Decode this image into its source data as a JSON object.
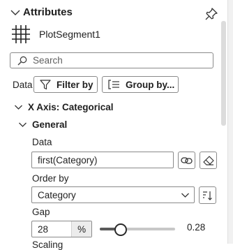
{
  "panel": {
    "title": "Attributes",
    "object_name": "PlotSegment1",
    "search_placeholder": "Search"
  },
  "data_row": {
    "label": "Data",
    "filter_label": "Filter by",
    "group_label": "Group by..."
  },
  "x_axis": {
    "section_label": "X Axis: Categorical",
    "general_label": "General",
    "data_label": "Data",
    "data_value": "first(Category)",
    "order_label": "Order by",
    "order_value": "Category",
    "gap_label": "Gap",
    "gap_value": "28",
    "gap_unit": "%",
    "gap_slider_fraction": 0.28,
    "gap_slider_text": "0.28",
    "next_label_partial": "Scaling"
  },
  "icons": [
    "chevron-down-icon",
    "pin-icon",
    "grid-icon",
    "search-icon",
    "filter-icon",
    "group-icon",
    "link-icon",
    "eraser-icon",
    "sort-icon"
  ]
}
